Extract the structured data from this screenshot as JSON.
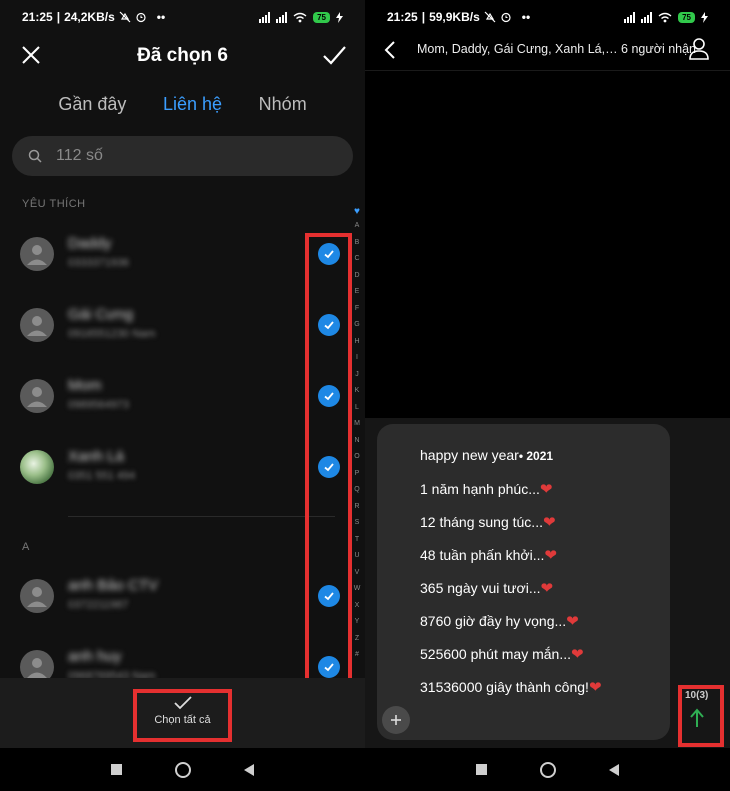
{
  "left_screen": {
    "status": {
      "time": "21:25",
      "speed": "24,2KB/s",
      "battery": "75"
    },
    "header": {
      "title": "Đã chọn 6"
    },
    "tabs": [
      {
        "label": "Gần đây",
        "active": false
      },
      {
        "label": "Liên hệ",
        "active": true
      },
      {
        "label": "Nhóm",
        "active": false
      }
    ],
    "search": {
      "placeholder": "112 số"
    },
    "sections": {
      "favorites": "YÊU THÍCH",
      "a": "A"
    },
    "contacts": [
      {
        "name": "Daddy",
        "number": "0333371936",
        "selected": true,
        "avatar": "person-icon"
      },
      {
        "name": "Gái Cưng",
        "number": "0916551230 Nam",
        "selected": true,
        "avatar": "person-icon"
      },
      {
        "name": "Mom",
        "number": "0989564973",
        "selected": true,
        "avatar": "person-icon"
      },
      {
        "name": "Xanh Lá",
        "number": "0351 551 494",
        "selected": true,
        "avatar": "photo"
      },
      {
        "name": "anh Bảo CTV",
        "number": "0372211987",
        "selected": true,
        "avatar": "person-icon"
      },
      {
        "name": "anh huy",
        "number": "0968769543 Nam",
        "selected": true,
        "avatar": "person-icon"
      }
    ],
    "alphabet": [
      "A",
      "B",
      "C",
      "D",
      "E",
      "F",
      "G",
      "H",
      "I",
      "J",
      "K",
      "L",
      "M",
      "N",
      "O",
      "P",
      "Q",
      "R",
      "S",
      "T",
      "U",
      "V",
      "W",
      "X",
      "Y",
      "Z",
      "#"
    ],
    "select_all_label": "Chọn tất cả"
  },
  "right_screen": {
    "status": {
      "time": "21:25",
      "speed": "59,9KB/s",
      "battery": "75"
    },
    "recipients": "Mom, Daddy, Gái Cưng, Xanh Lá,… 6 người nhận",
    "message_lines": [
      {
        "text": "happy new year",
        "suffix": "• 2021"
      },
      {
        "text": "1 năm hạnh phúc...",
        "suffix": "❤"
      },
      {
        "text": "12 tháng sung túc...",
        "suffix": "❤"
      },
      {
        "text": "48 tuần phấn khởi...",
        "suffix": "❤"
      },
      {
        "text": "365 ngày vui tươi...",
        "suffix": "❤"
      },
      {
        "text": "8760 giờ đầy hy vọng...",
        "suffix": "❤"
      },
      {
        "text": "525600 phút may mắn...",
        "suffix": "❤"
      },
      {
        "text": "31536000 giây thành công!",
        "suffix": "❤"
      }
    ],
    "counter": "10(3)"
  },
  "colors": {
    "accent_blue": "#1e88e5",
    "tab_active": "#3b9eff",
    "highlight_red": "#e53030",
    "send_green": "#2fae53",
    "heart_red": "#e03a3a"
  }
}
